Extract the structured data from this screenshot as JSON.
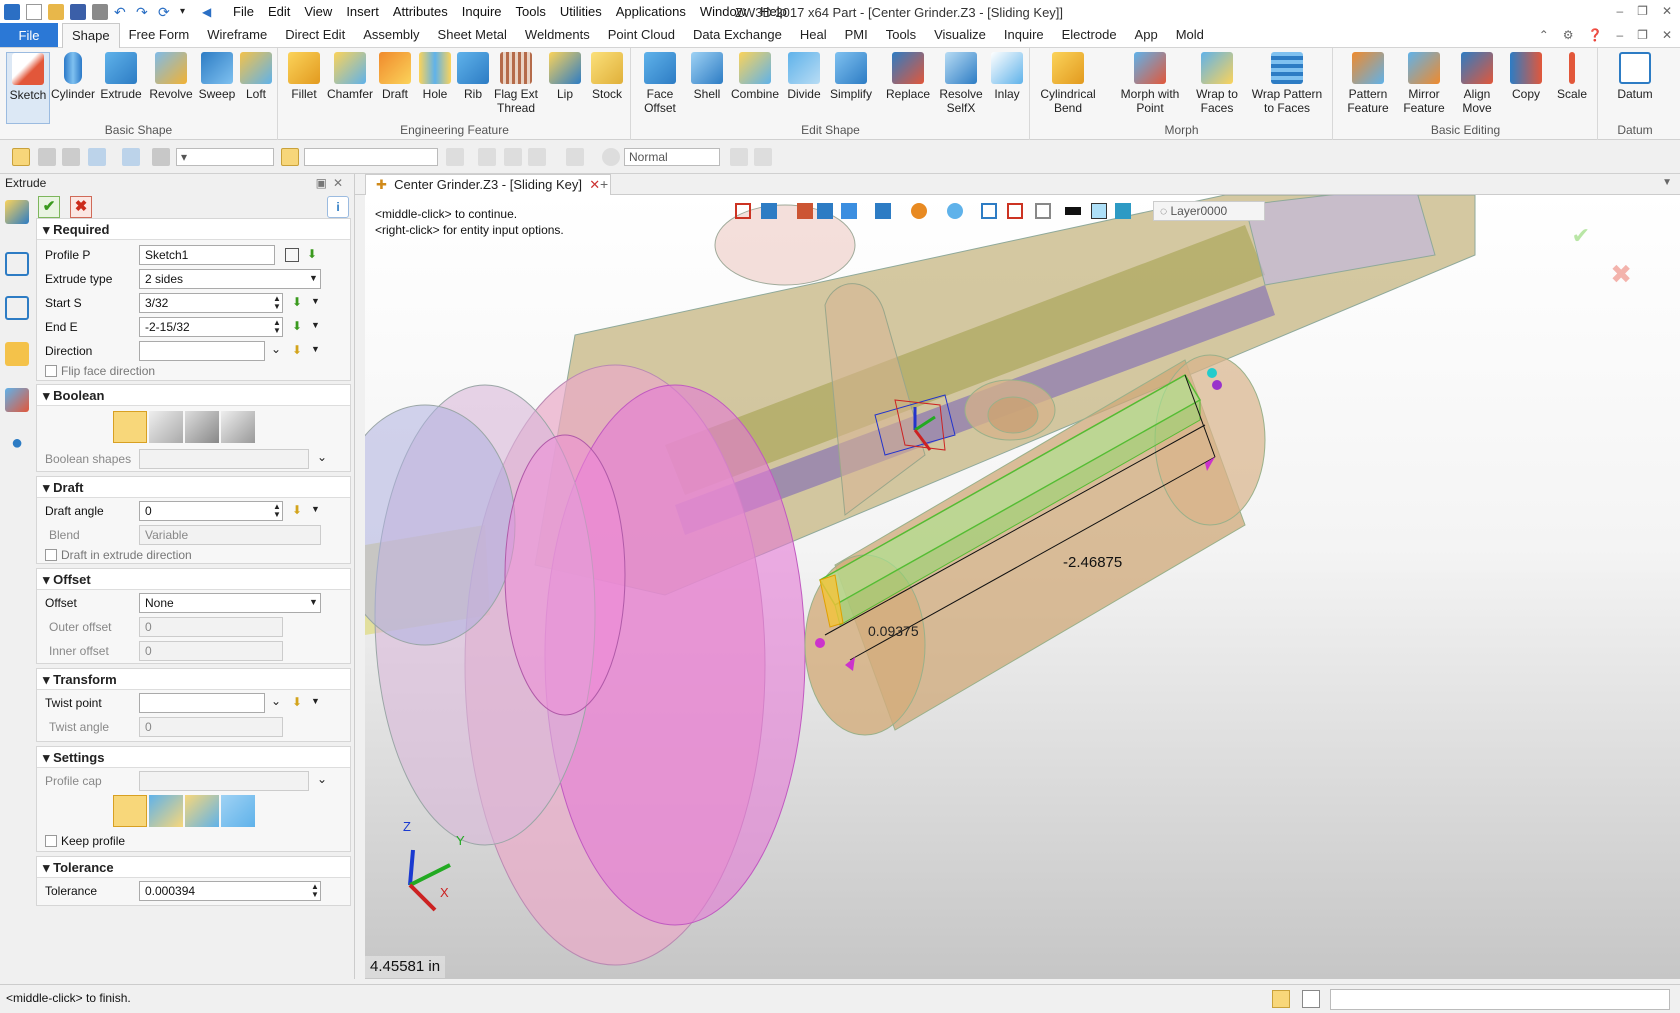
{
  "app": {
    "title": "ZW3D 2017  x64       Part - [Center Grinder.Z3 - [Sliding Key]]",
    "menu": [
      "File",
      "Edit",
      "View",
      "Insert",
      "Attributes",
      "Inquire",
      "Tools",
      "Utilities",
      "Applications",
      "Window",
      "Help"
    ]
  },
  "ribbon_tabs": [
    "Shape",
    "Free Form",
    "Wireframe",
    "Direct Edit",
    "Assembly",
    "Sheet Metal",
    "Weldments",
    "Point Cloud",
    "Data Exchange",
    "Heal",
    "PMI",
    "Tools",
    "Visualize",
    "Inquire",
    "Electrode",
    "App",
    "Mold"
  ],
  "file_tab": "File",
  "active_tab": "Shape",
  "ribbon": {
    "groups": [
      {
        "label": "Basic Shape",
        "buttons": [
          "Sketch",
          "Cylinder",
          "Extrude",
          "Revolve",
          "Sweep",
          "Loft"
        ]
      },
      {
        "label": "Engineering Feature",
        "buttons": [
          "Fillet",
          "Chamfer",
          "Draft",
          "Hole",
          "Rib",
          "Flag Ext Thread",
          "Lip",
          "Stock"
        ]
      },
      {
        "label": "Edit Shape",
        "buttons": [
          "Face Offset",
          "Shell",
          "Combine",
          "Divide",
          "Simplify",
          "Replace",
          "Resolve SelfX",
          "Inlay"
        ]
      },
      {
        "label": "Morph",
        "buttons": [
          "Cylindrical Bend",
          "Morph with Point",
          "Wrap to Faces",
          "Wrap Pattern to Faces"
        ]
      },
      {
        "label": "Basic Editing",
        "buttons": [
          "Pattern Feature",
          "Mirror Feature",
          "Align Move",
          "Copy",
          "Scale"
        ]
      },
      {
        "label": "Datum",
        "buttons": [
          "Datum"
        ]
      }
    ]
  },
  "toolbar": {
    "render_mode": "Normal"
  },
  "panel": {
    "title": "Extrude",
    "required": {
      "header": "Required",
      "profile_label": "Profile P",
      "profile_value": "Sketch1",
      "extrude_type_label": "Extrude type",
      "extrude_type_value": "2 sides",
      "start_label": "Start S",
      "start_value": "3/32",
      "end_label": "End E",
      "end_value": "-2-15/32",
      "direction_label": "Direction",
      "direction_value": "",
      "flip_label": "Flip face direction"
    },
    "boolean": {
      "header": "Boolean",
      "shapes_label": "Boolean shapes"
    },
    "draft": {
      "header": "Draft",
      "angle_label": "Draft angle",
      "angle_value": "0",
      "blend_label": "Blend",
      "blend_value": "Variable",
      "in_dir_label": "Draft in extrude direction"
    },
    "offset": {
      "header": "Offset",
      "offset_label": "Offset",
      "offset_value": "None",
      "outer_label": "Outer offset",
      "outer_value": "0",
      "inner_label": "Inner offset",
      "inner_value": "0"
    },
    "transform": {
      "header": "Transform",
      "twist_point_label": "Twist point",
      "twist_point_value": "",
      "twist_angle_label": "Twist angle",
      "twist_angle_value": "0"
    },
    "settings": {
      "header": "Settings",
      "profile_cap_label": "Profile cap",
      "keep_profile_label": "Keep profile"
    },
    "tolerance": {
      "header": "Tolerance",
      "label": "Tolerance",
      "value": "0.000394"
    }
  },
  "doc_tab": "Center Grinder.Z3 - [Sliding Key]",
  "viewport": {
    "hint1": "<middle-click> to continue.",
    "hint2": "<right-click> for entity input options.",
    "layer": "Layer0000",
    "dim_length": "-2.46875",
    "dim_start": "0.09375",
    "measure": "4.45581 in",
    "axis_z": "Z",
    "axis_y": "Y",
    "axis_x": "X"
  },
  "status": {
    "text": "<middle-click> to finish."
  }
}
